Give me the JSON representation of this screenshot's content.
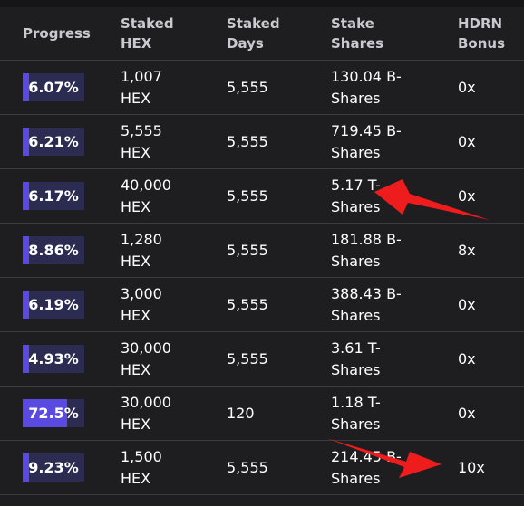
{
  "headers": {
    "progress": "Progress",
    "staked_hex": [
      "Staked",
      "HEX"
    ],
    "staked_days": [
      "Staked",
      "Days"
    ],
    "stake_shares": [
      "Stake",
      "Shares"
    ],
    "hdrn_bonus": [
      "HDRN",
      "Bonus"
    ]
  },
  "rows": [
    {
      "progress_label": "6.07%",
      "progress": 0.0607,
      "hex": "1,007",
      "hex_unit": "HEX",
      "days": "5,555",
      "shares": "130.04 B-",
      "shares_unit": "Shares",
      "bonus": "0x"
    },
    {
      "progress_label": "6.21%",
      "progress": 0.0621,
      "hex": "5,555",
      "hex_unit": "HEX",
      "days": "5,555",
      "shares": "719.45 B-",
      "shares_unit": "Shares",
      "bonus": "0x"
    },
    {
      "progress_label": "6.17%",
      "progress": 0.0617,
      "hex": "40,000",
      "hex_unit": "HEX",
      "days": "5,555",
      "shares": "5.17 T-",
      "shares_unit": "Shares",
      "bonus": "0x"
    },
    {
      "progress_label": "8.86%",
      "progress": 0.0886,
      "hex": "1,280",
      "hex_unit": "HEX",
      "days": "5,555",
      "shares": "181.88 B-",
      "shares_unit": "Shares",
      "bonus": "8x"
    },
    {
      "progress_label": "6.19%",
      "progress": 0.0619,
      "hex": "3,000",
      "hex_unit": "HEX",
      "days": "5,555",
      "shares": "388.43 B-",
      "shares_unit": "Shares",
      "bonus": "0x"
    },
    {
      "progress_label": "4.93%",
      "progress": 0.0493,
      "hex": "30,000",
      "hex_unit": "HEX",
      "days": "5,555",
      "shares": "3.61 T-",
      "shares_unit": "Shares",
      "bonus": "0x"
    },
    {
      "progress_label": "72.5%",
      "progress": 0.725,
      "hex": "30,000",
      "hex_unit": "HEX",
      "days": "120",
      "shares": "1.18 T-",
      "shares_unit": "Shares",
      "bonus": "0x"
    },
    {
      "progress_label": "9.23%",
      "progress": 0.0923,
      "hex": "1,500",
      "hex_unit": "HEX",
      "days": "5,555",
      "shares": "214.45 B-",
      "shares_unit": "Shares",
      "bonus": "10x"
    }
  ],
  "colors": {
    "bar_fill": "#5b4ae0",
    "bar_track": "#2c2c52",
    "arrow": "#ee1c1c"
  }
}
